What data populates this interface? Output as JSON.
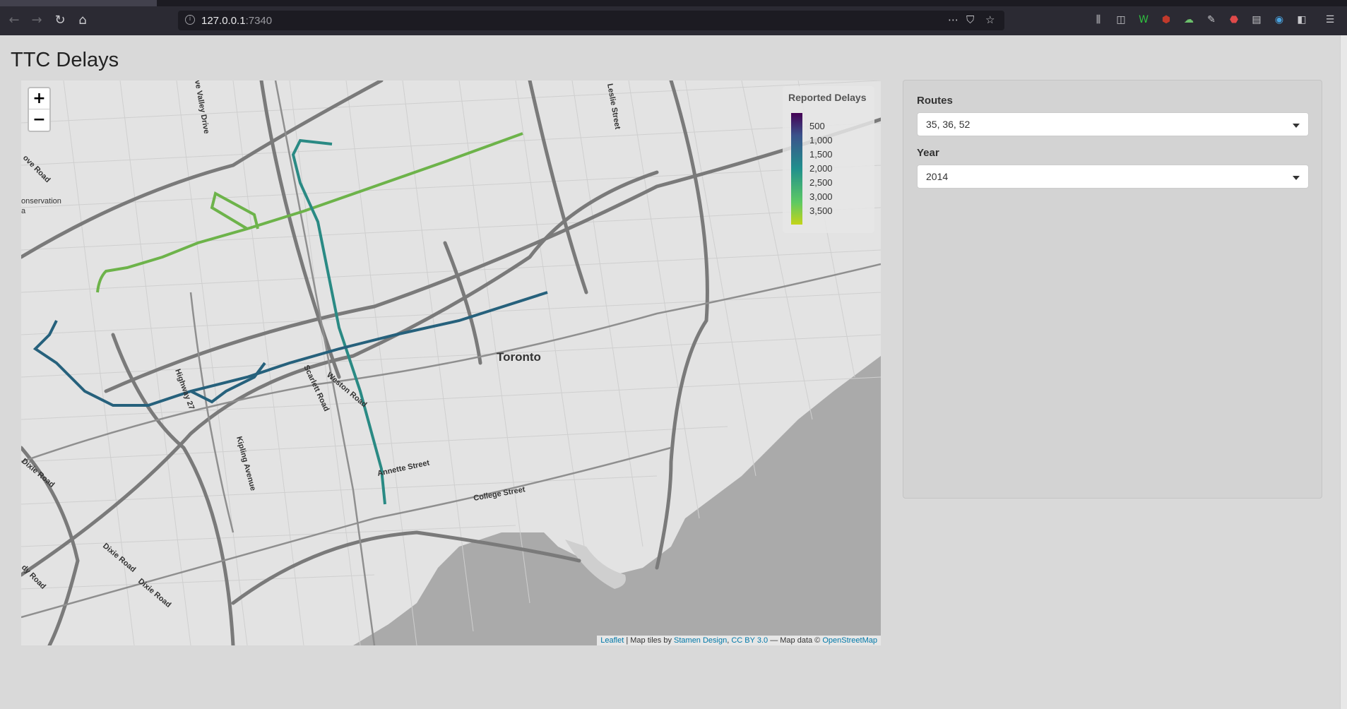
{
  "browser": {
    "url_host": "127.0.0.1",
    "url_port": ":7340"
  },
  "page": {
    "title": "TTC Delays"
  },
  "map": {
    "zoom_in_label": "+",
    "zoom_out_label": "−",
    "city_label": "Toronto",
    "street_labels": [
      "Leslie Street",
      "Scarlett Road",
      "Weston Road",
      "Highway 27",
      "Kipling Avenue",
      "Annette Street",
      "College Street",
      "Dixie Road",
      "Dixie Road",
      "Dixie Road",
      "Dixie Road",
      "ve Valley Drive",
      "ove Road",
      "onservation",
      "a",
      "dy Road"
    ],
    "legend": {
      "title": "Reported Delays",
      "ticks": [
        "500",
        "1,000",
        "1,500",
        "2,000",
        "2,500",
        "3,000",
        "3,500"
      ],
      "colors": [
        "#440154",
        "#3b528b",
        "#21908d",
        "#5dc963",
        "#c4d418"
      ]
    },
    "attribution": {
      "leaflet": "Leaflet",
      "sep1": " | Map tiles by ",
      "stamen": "Stamen Design",
      "sep2": ", ",
      "license": "CC BY 3.0",
      "sep3": " — Map data © ",
      "osm": "OpenStreetMap"
    },
    "route_colors": {
      "green_route": "#6db34a",
      "teal_route": "#2a8a84",
      "blue_route": "#26617c"
    }
  },
  "sidebar": {
    "routes_label": "Routes",
    "routes_value": "35, 36, 52",
    "year_label": "Year",
    "year_value": "2014"
  }
}
